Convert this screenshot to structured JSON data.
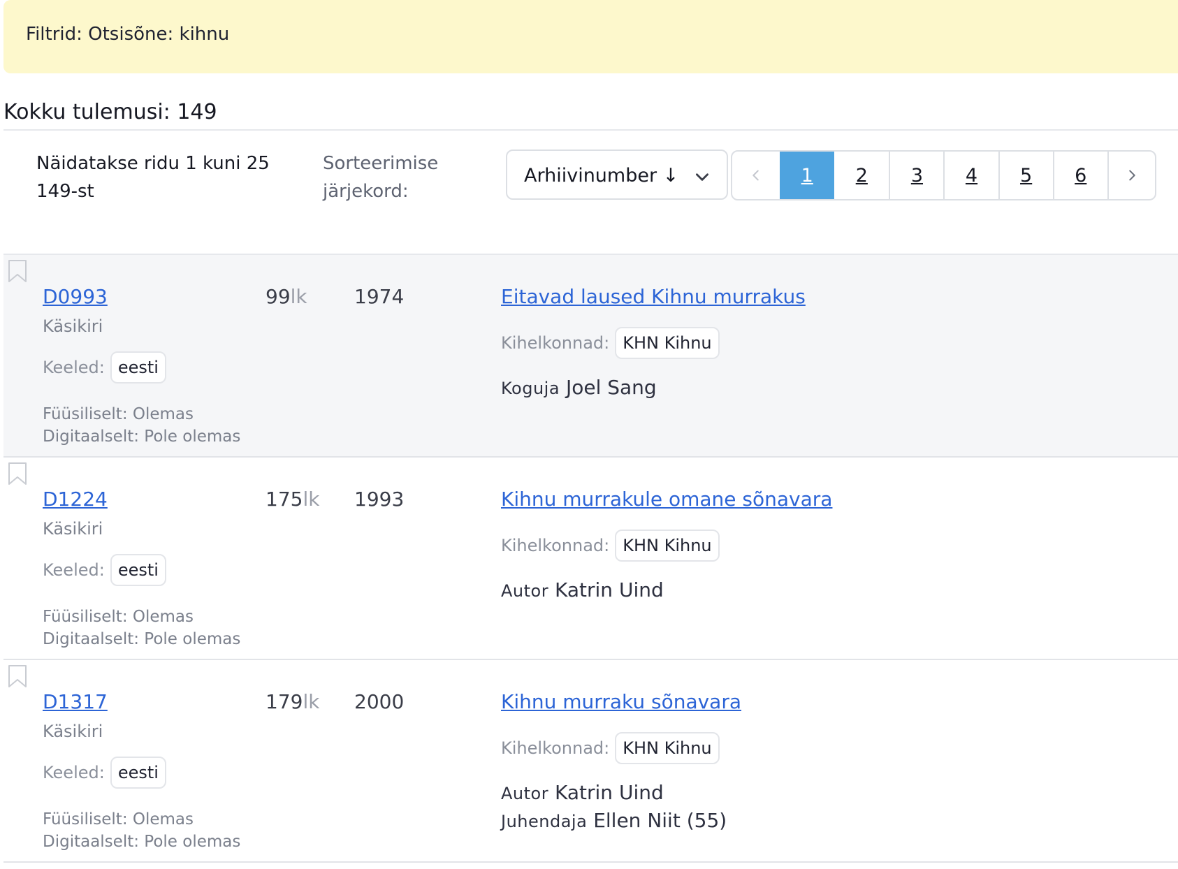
{
  "filter_banner": {
    "text": "Filtrid: Otsisõne: kihnu"
  },
  "summary": {
    "total": "Kokku tulemusi: 149"
  },
  "toolbar": {
    "showing_line1": "Näidatakse ridu 1 kuni 25",
    "showing_line2": "149-st",
    "sort_label_line1": "Sorteerimise",
    "sort_label_line2": "järjekord:",
    "sort_value": "Arhiivinumber ↓"
  },
  "pagination": {
    "prev_icon": "chevron-left-icon",
    "next_icon": "chevron-right-icon",
    "pages": [
      "1",
      "2",
      "3",
      "4",
      "5",
      "6"
    ],
    "active": "1"
  },
  "labels": {
    "languages": "Keeled:",
    "parishes": "Kihelkonnad:",
    "pages_unit": "lk"
  },
  "results": [
    {
      "ref": "D0993",
      "type": "Käsikiri",
      "language": "eesti",
      "physical": "Füüsiliselt: Olemas",
      "digital": "Digitaalselt: Pole olemas",
      "pages": "99",
      "year": "1974",
      "title": "Eitavad laused Kihnu murrakus",
      "parish": "KHN Kihnu",
      "people": [
        {
          "role": "Koguja",
          "name": "Joel Sang"
        }
      ]
    },
    {
      "ref": "D1224",
      "type": "Käsikiri",
      "language": "eesti",
      "physical": "Füüsiliselt: Olemas",
      "digital": "Digitaalselt: Pole olemas",
      "pages": "175",
      "year": "1993",
      "title": "Kihnu murrakule omane sõnavara",
      "parish": "KHN Kihnu",
      "people": [
        {
          "role": "Autor",
          "name": "Katrin Uind"
        }
      ]
    },
    {
      "ref": "D1317",
      "type": "Käsikiri",
      "language": "eesti",
      "physical": "Füüsiliselt: Olemas",
      "digital": "Digitaalselt: Pole olemas",
      "pages": "179",
      "year": "2000",
      "title": "Kihnu murraku sõnavara",
      "parish": "KHN Kihnu",
      "people": [
        {
          "role": "Autor",
          "name": "Katrin Uind"
        },
        {
          "role": "Juhendaja",
          "name": "Ellen Niit (55)"
        }
      ]
    }
  ],
  "colors": {
    "banner_bg": "#fdf8cc",
    "link": "#2c64d6",
    "active_page": "#4ea3df",
    "shaded_row": "#f5f6f8"
  }
}
